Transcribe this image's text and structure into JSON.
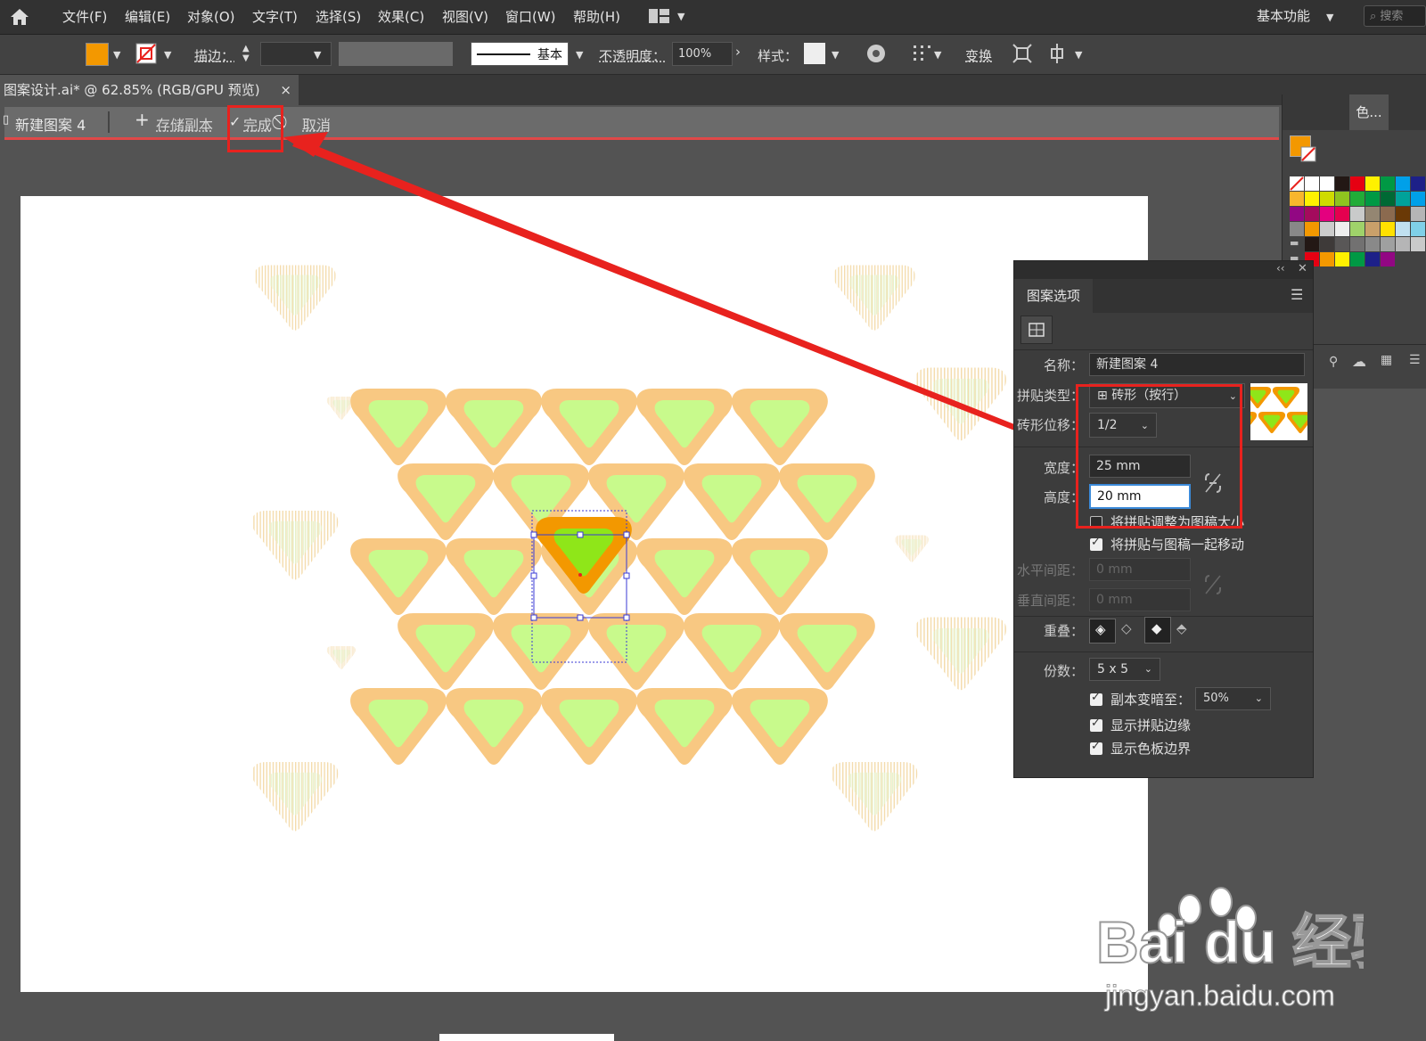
{
  "menubar": {
    "items": [
      "文件(F)",
      "编辑(E)",
      "对象(O)",
      "文字(T)",
      "选择(S)",
      "效果(C)",
      "视图(V)",
      "窗口(W)",
      "帮助(H)"
    ],
    "workspace": "基本功能",
    "search_placeholder": "搜索"
  },
  "controlbar": {
    "stroke_label": "描边：",
    "stroke_style": "基本",
    "opacity_label": "不透明度：",
    "opacity_value": "100%",
    "style_label": "样式：",
    "transform_label": "变换",
    "fill_color": "#f39800"
  },
  "tab": {
    "title": "图案设计.ai* @ 62.85% (RGB/GPU 预览)",
    "close": "×"
  },
  "pattern_bar": {
    "name": "新建图案 4",
    "save_copy": "存储副本",
    "done": "完成",
    "cancel": "取消"
  },
  "color_panel": {
    "tab": "色..."
  },
  "pattern_options": {
    "title": "图案选项",
    "name_label": "名称：",
    "name_value": "新建图案 4",
    "tile_type_label": "拼贴类型：",
    "tile_type_value": "砖形（按行）",
    "brick_offset_label": "砖形位移：",
    "brick_offset_value": "1/2",
    "width_label": "宽度：",
    "width_value": "25 mm",
    "height_label": "高度：",
    "height_value": "20 mm",
    "size_tile_label": "将拼贴调整为图稿大小",
    "move_tile_label": "将拼贴与图稿一起移动",
    "h_spacing_label": "水平间距：",
    "h_spacing_value": "0 mm",
    "v_spacing_label": "垂直间距：",
    "v_spacing_value": "0 mm",
    "overlap_label": "重叠：",
    "copies_label": "份数：",
    "copies_value": "5 x 5",
    "dim_copies_label": "副本变暗至：",
    "dim_copies_value": "50%",
    "show_tile_edge_label": "显示拼贴边缘",
    "show_swatch_bounds_label": "显示色板边界",
    "checkbox_states": {
      "size_tile": false,
      "move_tile": true,
      "dim_copies": true,
      "show_tile_edge": true,
      "show_swatch_bounds": true
    }
  },
  "watermark": {
    "brand": "Bai du 经验",
    "url": "jingyan.baidu.com"
  },
  "colors": {
    "outer": "#f8c882",
    "inner": "#c8fa8c",
    "sel_outer": "#f39800",
    "sel_inner": "#8fe619",
    "accent_red": "#e8221e"
  }
}
